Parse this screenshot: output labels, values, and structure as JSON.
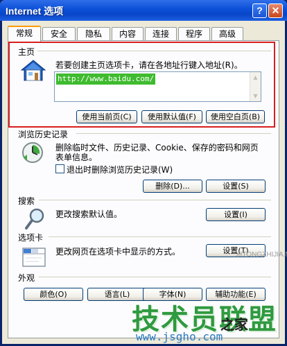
{
  "window": {
    "title": "Internet 选项",
    "help_glyph": "?",
    "close_glyph": "✕"
  },
  "tabs": [
    "常规",
    "安全",
    "隐私",
    "内容",
    "连接",
    "程序",
    "高级"
  ],
  "homepage": {
    "group_label": "主页",
    "instruction": "若要创建主页选项卡，请在各地址行键入地址(R)。",
    "address_value": "http://www.baidu.com/",
    "buttons": [
      "使用当前页(C)",
      "使用默认值(F)",
      "使用空白页(B)"
    ]
  },
  "history": {
    "group_label": "浏览历史记录",
    "description_line1": "删除临时文件、历史记录、Cookie、保存的密码和网页",
    "description_line2": "表单信息。",
    "checkbox_label": "退出时删除浏览历史记录(W)",
    "checked": false,
    "delete_button": "删除(D)...",
    "settings_button": "设置(S)"
  },
  "search": {
    "group_label": "搜索",
    "description": "更改搜索默认值。",
    "settings_button": "设置(I)"
  },
  "tabs_group": {
    "group_label": "选项卡",
    "description": "更改网页在选项卡中显示的方式。",
    "settings_button": "设置(T)"
  },
  "appearance": {
    "group_label": "外观",
    "buttons": [
      "颜色(O)",
      "语言(L)",
      "字体(N)",
      "辅助功能(E)"
    ]
  },
  "watermarks": {
    "main": "技术员联盟",
    "suffix": "之家",
    "url": "www.jsgho.com",
    "faint": "XITONGZHIJIA.NET"
  },
  "colors": {
    "highlight_box": "#d81e1e",
    "selection": "#3ebb2e",
    "title_bar": "#0b4fd7"
  }
}
